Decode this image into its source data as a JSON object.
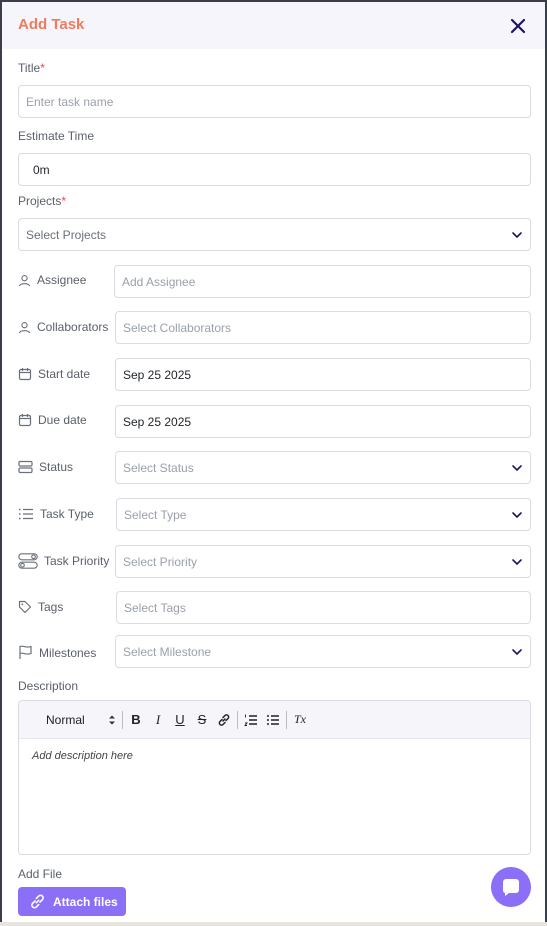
{
  "header": {
    "title": "Add Task"
  },
  "title_field": {
    "label": "Title",
    "required_mark": "*",
    "placeholder": "Enter task name"
  },
  "estimate": {
    "label": "Estimate Time",
    "value": "0m"
  },
  "projects": {
    "label": "Projects",
    "required_mark": "*",
    "placeholder": "Select Projects"
  },
  "rows": {
    "assignee": {
      "label": "Assignee",
      "placeholder": "Add Assignee",
      "icon": "user-icon"
    },
    "collaborators": {
      "label": "Collaborators",
      "placeholder": "Select Collaborators",
      "icon": "user-icon"
    },
    "start_date": {
      "label": "Start date",
      "value": "Sep 25 2025",
      "icon": "calendar-icon"
    },
    "due_date": {
      "label": "Due date",
      "value": "Sep 25 2025",
      "icon": "calendar-icon"
    },
    "status": {
      "label": "Status",
      "placeholder": "Select Status",
      "icon": "status-icon"
    },
    "task_type": {
      "label": "Task Type",
      "placeholder": "Select Type",
      "icon": "list-icon"
    },
    "task_priority": {
      "label": "Task Priority",
      "placeholder": "Select Priority",
      "icon": "toggle-icon"
    },
    "tags": {
      "label": "Tags",
      "placeholder": "Select Tags",
      "icon": "tag-icon"
    },
    "milestones": {
      "label": "Milestones",
      "placeholder": "Select Milestone",
      "icon": "flag-icon"
    }
  },
  "description": {
    "label": "Description",
    "format_select": "Normal",
    "toolbar": {
      "bold": "B",
      "italic": "I",
      "underline": "U",
      "strike": "S",
      "clear": "Tx"
    },
    "placeholder": "Add description here"
  },
  "attachments": {
    "label": "Add File",
    "button_label": "Attach files"
  },
  "colors": {
    "accent": "#8b6ff7",
    "title": "#f07a5e",
    "required": "#e5484d"
  }
}
